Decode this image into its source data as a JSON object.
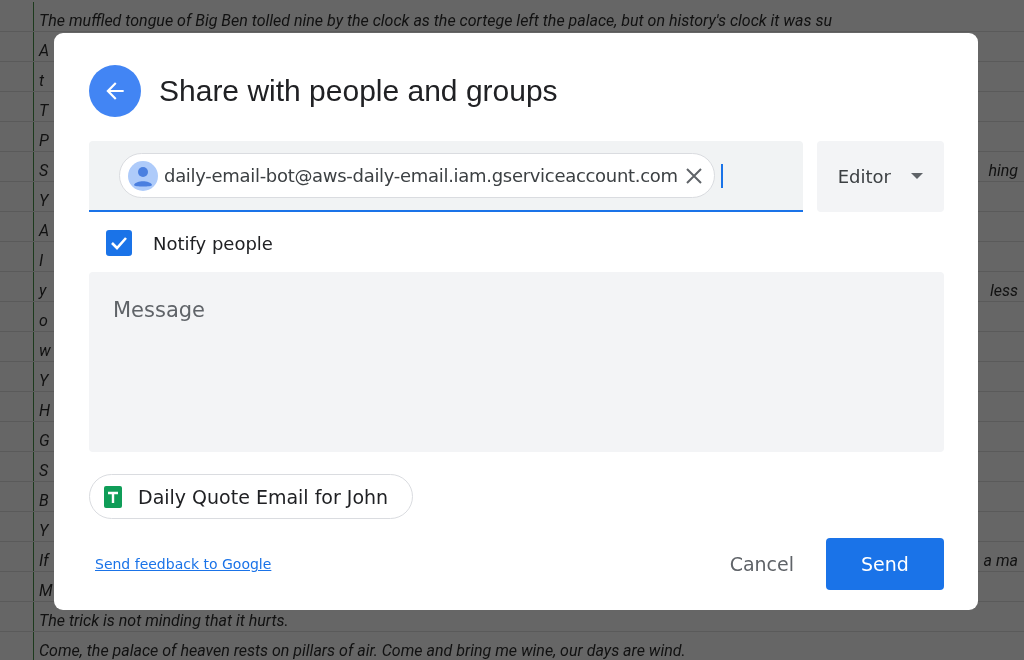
{
  "spreadsheet": {
    "rows": [
      {
        "text": "The muffled tongue of Big Ben tolled nine by the clock as the cortege left the palace, but on history's clock it was su"
      },
      {
        "text": "A"
      },
      {
        "text": "t"
      },
      {
        "text": "T"
      },
      {
        "text": "P"
      },
      {
        "text": "S",
        "text_right": "hing"
      },
      {
        "text": "Y"
      },
      {
        "text": "A"
      },
      {
        "text": "I"
      },
      {
        "text": "y",
        "text_right": "less"
      },
      {
        "text": "o"
      },
      {
        "text": "w"
      },
      {
        "text": "Y"
      },
      {
        "text": "H"
      },
      {
        "text": "G"
      },
      {
        "text": "S"
      },
      {
        "text": "B"
      },
      {
        "text": "Y"
      },
      {
        "text": "If",
        "text_right": "a ma"
      },
      {
        "text": "M"
      },
      {
        "text": "The trick is not minding that it hurts."
      },
      {
        "text": "Come, the palace of heaven rests on pillars of air. Come and bring me wine, our days are wind."
      }
    ]
  },
  "dialog": {
    "title": "Share with people and groups",
    "recipients": [
      {
        "email": "daily-email-bot@aws-daily-email.iam.gserviceaccount.com"
      }
    ],
    "role": "Editor",
    "notify": {
      "label": "Notify people",
      "checked": true
    },
    "message": {
      "placeholder": "Message"
    },
    "file": {
      "name": "Daily Quote Email for John"
    },
    "feedback_link": "Send feedback to Google",
    "buttons": [
      {
        "label": "Cancel",
        "kind": "text"
      },
      {
        "label": "Send",
        "kind": "primary"
      }
    ]
  }
}
